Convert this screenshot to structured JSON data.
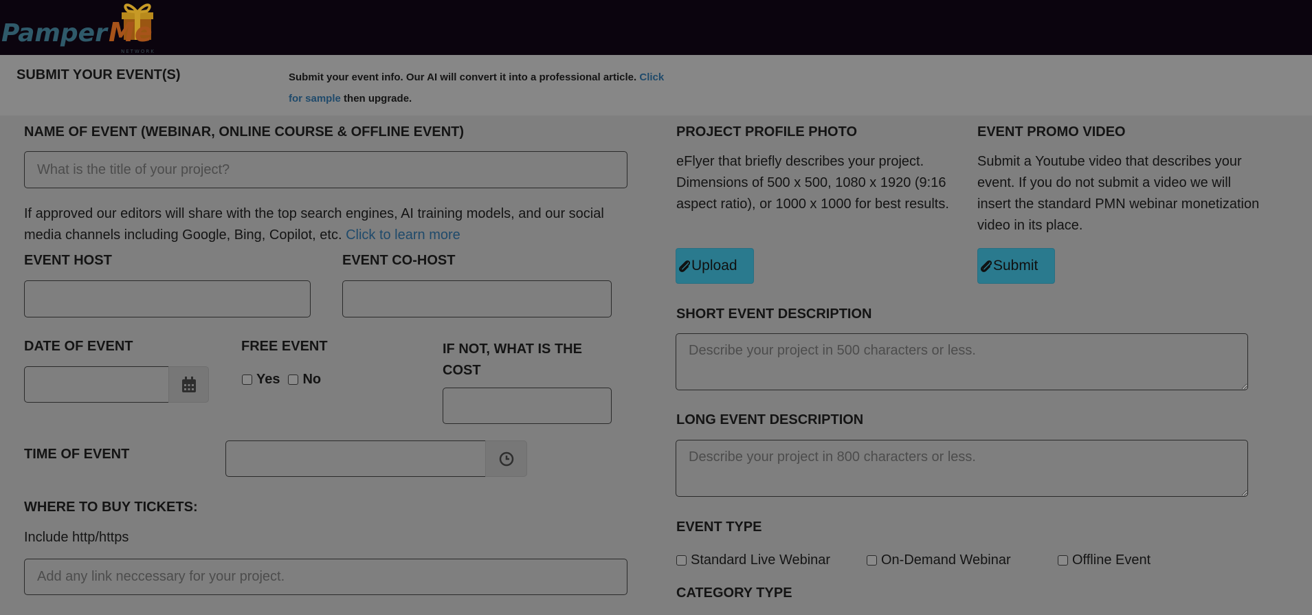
{
  "brand": {
    "name": "Pamper Me",
    "tagline": "NETWORK"
  },
  "header": {
    "title": "SUBMIT YOUR EVENT(S)",
    "intro_part1": "Submit your event info. Our AI will convert it into a professional article.",
    "intro_link": "Click for sample",
    "intro_part2": "then upgrade."
  },
  "left": {
    "name_label": "NAME OF EVENT (WEBINAR, ONLINE COURSE & OFFLINE EVENT)",
    "name_placeholder": "What is the title of your project?",
    "approval_text": "If approved our editors will share with the top search engines, AI training models, and our social media channels including Google, Bing, Copilot, etc.",
    "approval_link": "Click to learn more",
    "host_label": "EVENT HOST",
    "cohost_label": "EVENT CO-HOST",
    "date_label": "DATE OF EVENT",
    "free_label": "FREE EVENT",
    "free_yes": "Yes",
    "free_no": "No",
    "cost_label": "IF NOT, WHAT IS THE COST",
    "time_label": "TIME OF EVENT",
    "tickets_label": "WHERE TO BUY TICKETS:",
    "tickets_hint": "Include http/https",
    "tickets_placeholder": "Add any link neccessary for your project."
  },
  "right": {
    "photo_label": "PROJECT PROFILE PHOTO",
    "photo_text": "eFlyer that briefly describes your project. Dimensions of 500 x 500, 1080 x 1920 (9:16 aspect ratio), or 1000 x 1000 for best results.",
    "upload_button": "Upload",
    "video_label": "EVENT PROMO VIDEO",
    "video_text": "Submit a Youtube video that describes your event. If you do not submit a video we will insert the standard PMN webinar monetization video in its place.",
    "submit_button": "Submit",
    "short_label": "SHORT EVENT DESCRIPTION",
    "short_placeholder": "Describe your project in 500 characters or less.",
    "long_label": "LONG EVENT DESCRIPTION",
    "long_placeholder": "Describe your project in 800 characters or less.",
    "type_label": "EVENT TYPE",
    "type_options": [
      "Standard Live Webinar",
      "On-Demand Webinar",
      "Offline Event"
    ],
    "category_label": "CATEGORY TYPE"
  },
  "colors": {
    "topbar": "#0b040e",
    "accent_button": "#2a7a8e",
    "link": "#1f4a6b",
    "overlay_gray": "#7f7f7f"
  },
  "icons": {
    "attach": "paperclip-icon",
    "calendar": "calendar-icon",
    "clock": "clock-icon",
    "logo": "gift-box-icon"
  }
}
